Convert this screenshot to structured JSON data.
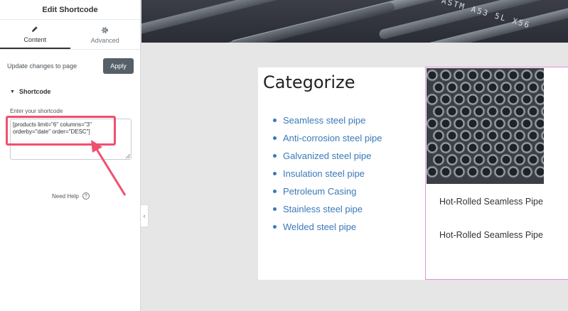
{
  "editor": {
    "title": "Edit Shortcode",
    "tabs": [
      {
        "label": "Content",
        "icon": "pencil-icon",
        "active": true
      },
      {
        "label": "Advanced",
        "icon": "gear-icon",
        "active": false
      }
    ],
    "update_label": "Update changes to page",
    "apply_label": "Apply",
    "section_label": "Shortcode",
    "field_label": "Enter your shortcode",
    "shortcode_value": "[products limit=\"6\" columns=\"3\" orderby=\"date\" order=\"DESC\"]",
    "help_label": "Need Help",
    "collapse_icon": "chevron-left-icon"
  },
  "preview": {
    "hero_text": "ASTM A53 5L X56",
    "category_title": "Categorize",
    "categories": [
      "Seamless steel pipe",
      "Anti-corrosion steel pipe",
      "Galvanized steel pipe",
      "Insulation steel pipe",
      "Petroleum Casing",
      "Stainless steel pipe",
      "Welded steel pipe"
    ],
    "products": [
      "Hot-Rolled Seamless Pipe",
      "Hot-Rolled Seamless Pipe"
    ]
  },
  "colors": {
    "accent_link": "#3a79b8",
    "highlight": "#f0506e",
    "apply_button": "#556068",
    "product_border": "#e08fe0"
  }
}
